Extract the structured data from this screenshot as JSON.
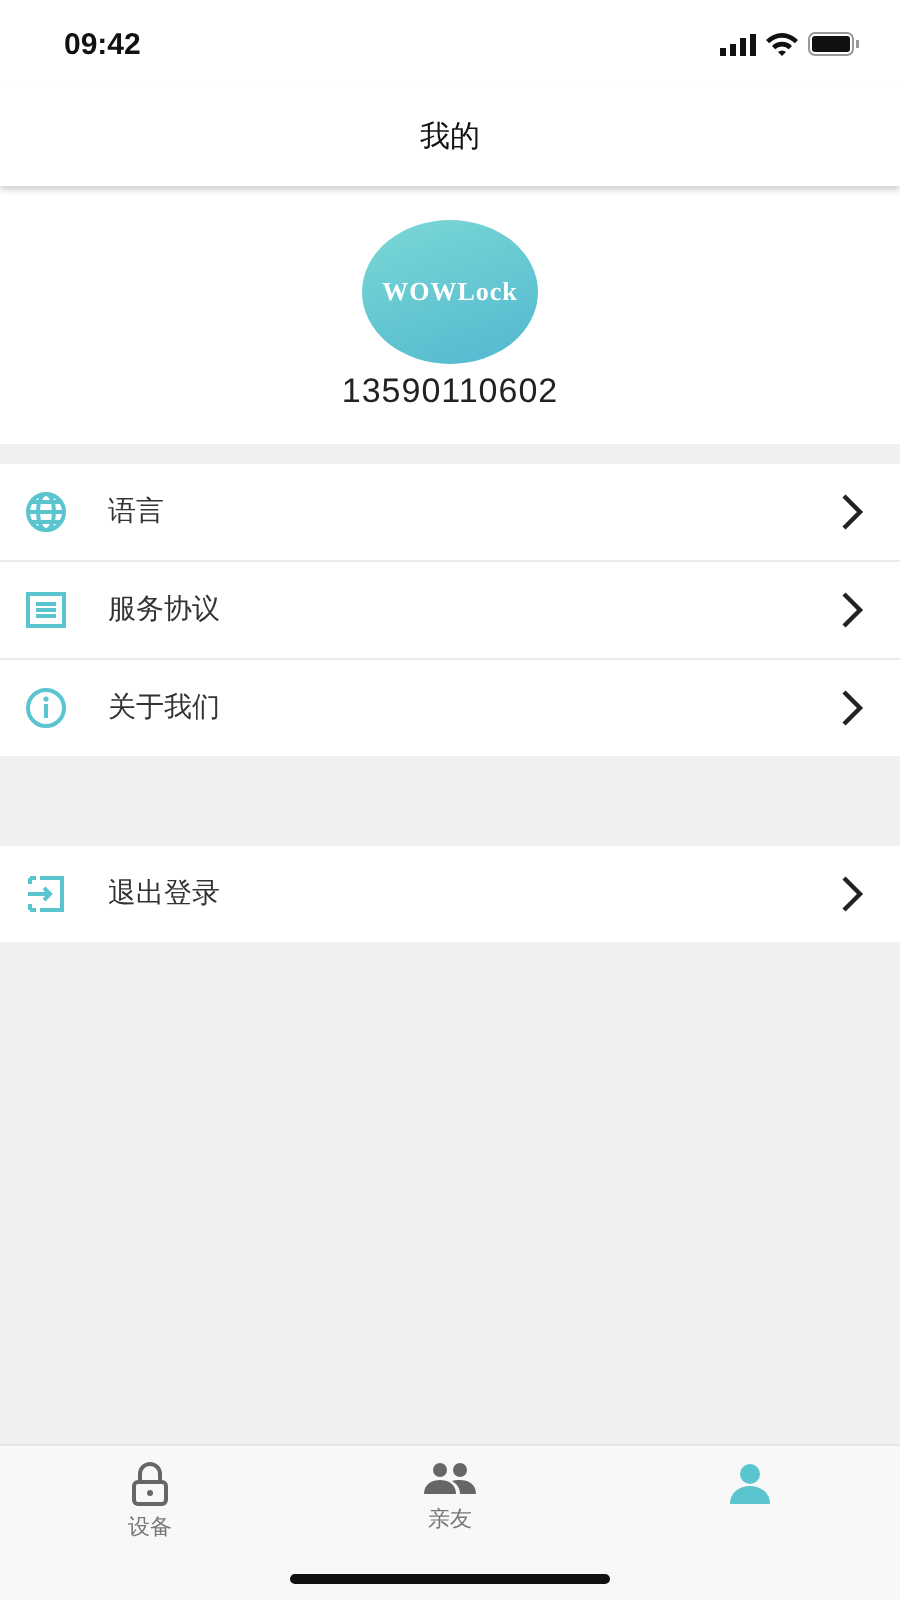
{
  "status_bar": {
    "time": "09:42"
  },
  "nav_bar": {
    "title": "我的"
  },
  "profile": {
    "avatar_text": "WOWLock",
    "phone": "13590110602"
  },
  "menu": [
    {
      "label": "语言"
    },
    {
      "label": "服务协议"
    },
    {
      "label": "关于我们"
    }
  ],
  "logout": {
    "label": "退出登录"
  },
  "tab_bar": [
    {
      "label": "设备",
      "selected": false
    },
    {
      "label": "亲友",
      "selected": false
    },
    {
      "selected": true
    }
  ]
}
